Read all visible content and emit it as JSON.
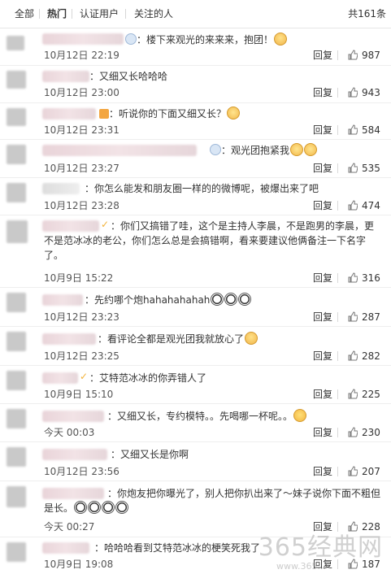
{
  "tabs": {
    "all": "全部",
    "hot": "热门",
    "verified": "认证用户",
    "following": "关注的人",
    "total": "共161条"
  },
  "reply_label": "回复",
  "comments": [
    {
      "text": "：楼下来观光的来来来，抱团！",
      "time": "10月12日 22:19",
      "likes": "987"
    },
    {
      "text": "：又细又长哈哈哈",
      "time": "10月12日 23:00",
      "likes": "943"
    },
    {
      "text": "：听说你的下面又细又长？",
      "time": "10月12日 23:31",
      "likes": "584"
    },
    {
      "text": "：观光团抱紧我",
      "time": "10月12日 23:27",
      "likes": "535"
    },
    {
      "text": "：你怎么能发和朋友圈一样的的微博呢，被爆出来了吧",
      "time": "10月12日 23:28",
      "likes": "474"
    },
    {
      "text": "：你们又搞错了哇，这个是主持人李晨，不是跑男的李晨，更不是范冰冰的老公，你们怎么总是会搞错啊，看来要建议他俩备注一下名字了。",
      "time": "10月9日 15:22",
      "likes": "316"
    },
    {
      "text": "：先约哪个炮hahahahahah",
      "time": "10月12日 23:23",
      "likes": "287"
    },
    {
      "text": "：看评论全都是观光团我就放心了",
      "time": "10月12日 23:25",
      "likes": "282"
    },
    {
      "text": "：艾特范冰冰的你弄错人了",
      "time": "10月9日 15:10",
      "likes": "225"
    },
    {
      "text": "：又细又长，专约模特。。先喝哪一杯呢。。",
      "time": "今天 00:03",
      "likes": "230"
    },
    {
      "text": "：又细又长是你啊",
      "time": "10月12日 23:56",
      "likes": "207"
    },
    {
      "text": "：你炮友把你曝光了，别人把你扒出来了～妹子说你下面不粗但是长。",
      "time": "今天 00:27",
      "likes": "228"
    },
    {
      "text": "：哈哈哈看到艾特范冰冰的梗笑死我了",
      "time": "10月9日 19:08",
      "likes": "187"
    }
  ],
  "watermark": {
    "brand": "365经典网",
    "url": "www.365..."
  },
  "icons": {
    "like": "thumbs-up-icon",
    "avatar": "blurred-avatar"
  }
}
